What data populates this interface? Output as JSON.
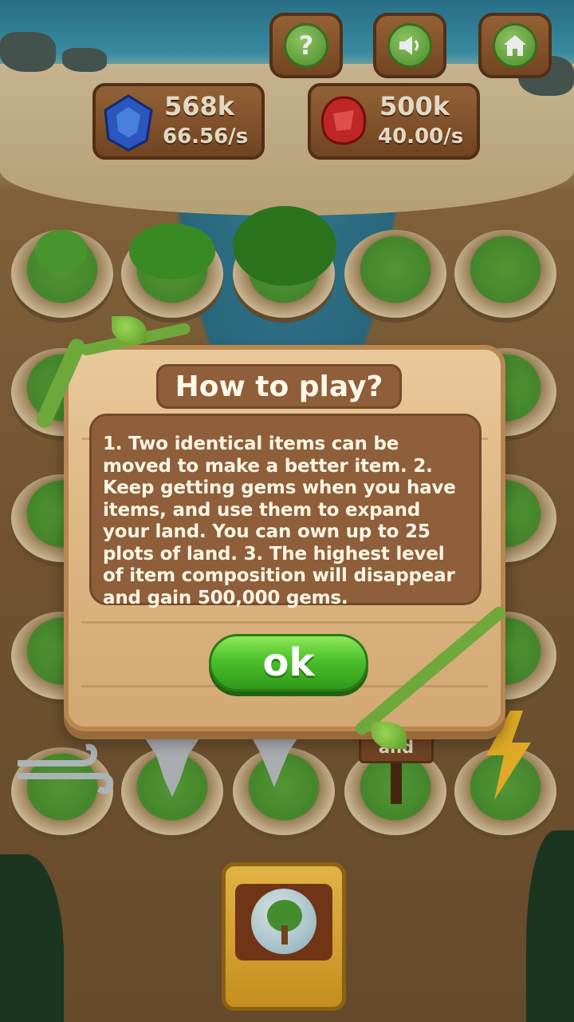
{
  "top_buttons": {
    "help_icon": "question-icon",
    "sound_icon": "speaker-icon",
    "home_icon": "home-icon",
    "help_symbol": "?"
  },
  "resources": {
    "blue_gem": {
      "amount": "568k",
      "rate": "66.56/s",
      "color": "#2f5fd0"
    },
    "red_gem": {
      "amount": "500k",
      "rate": "40.00/s",
      "color": "#d02a2a"
    }
  },
  "dialog": {
    "title": "How to play?",
    "body": "1. Two identical items can be moved to make a better item. 2. Keep getting gems when you have items, and use them to expand your land. You can own up to 25 plots of land. 3. The highest level of item composition will  disappear and gain 500,000 gems.",
    "ok_label": "ok"
  },
  "board": {
    "expand_sign": "and"
  },
  "colors": {
    "wood_dark": "#8f5e3a",
    "wood_light": "#e9c89a",
    "button_green": "#4cc12a",
    "text_light": "#fff6e4"
  }
}
